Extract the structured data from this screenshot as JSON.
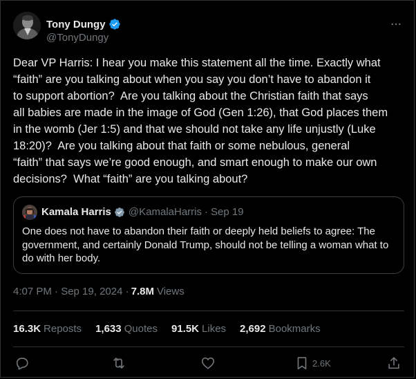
{
  "tweet": {
    "author": {
      "name": "Tony Dungy",
      "handle": "@TonyDungy",
      "verified": true
    },
    "text": "Dear VP Harris: I hear you make this statement all the time. Exactly what\n“faith” are you talking about when you say you don’t have to abandon it\nto support abortion?  Are you talking about the Christian faith that says\nall babies are made in the image of God (Gen 1:26), that God places them\nin the womb (Jer 1:5) and that we should not take any life unjustly (Luke\n18:20)?  Are you talking about that faith or some nebulous, general\n“faith” that says we’re good enough, and smart enough to make our own\ndecisions?  What “faith” are you talking about?",
    "timestamp": "4:07 PM · Sep 19, 2024 ·",
    "views_count": "7.8M",
    "views_label": "Views"
  },
  "quote": {
    "author_name": "Kamala Harris",
    "handle": "@KamalaHarris",
    "separator": "·",
    "date": "Sep 19",
    "text": "One does not have to abandon their faith or deeply held beliefs to agree: The\ngovernment, and certainly Donald Trump, should not be telling a woman what\nto do with her body."
  },
  "stats": {
    "reposts": {
      "value": "16.3K",
      "label": "Reposts"
    },
    "quotes": {
      "value": "1,633",
      "label": "Quotes"
    },
    "likes": {
      "value": "91.5K",
      "label": "Likes"
    },
    "bookmarks": {
      "value": "2,692",
      "label": "Bookmarks"
    }
  },
  "actions": {
    "reply": {
      "icon": "reply-icon"
    },
    "repost": {
      "icon": "repost-icon"
    },
    "like": {
      "icon": "heart-icon"
    },
    "bookmark": {
      "icon": "bookmark-icon",
      "count": "2.6K"
    },
    "share": {
      "icon": "share-icon"
    }
  },
  "colors": {
    "background": "#000000",
    "text": "#e7e9ea",
    "secondary_text": "#71767b",
    "border": "#2f3336",
    "verified_badge": "#1d9bf0"
  }
}
